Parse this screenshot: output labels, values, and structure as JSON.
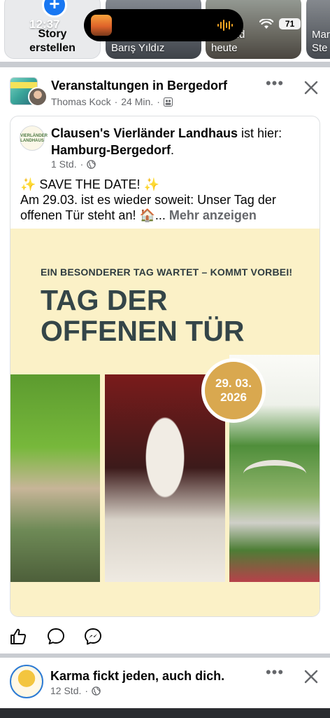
{
  "status_bar": {
    "time": "12:37",
    "battery": "71"
  },
  "stories": {
    "create_label": "Story\nerstellen",
    "items": [
      {
        "name": "Barış Yıldız"
      },
      {
        "name": "als und\nheute"
      },
      {
        "name": "Mar\nSte"
      }
    ]
  },
  "post": {
    "group_name": "Veranstaltungen in Bergedorf",
    "author": "Thomas Kock",
    "time": "24 Min.",
    "more_label": "•••",
    "shared": {
      "page_name": "Clausen's Vierländer Landhaus",
      "is_here_text": " ist hier: ",
      "location": "Hamburg-Bergedorf",
      "location_suffix": ".",
      "avatar_text": "VIERLÄNDER LANDHAUS",
      "time": "1 Std.",
      "body_line1": "✨ SAVE THE DATE! ✨",
      "body_line2": "Am 29.03. ist es wieder soweit: Unser Tag der offenen Tür steht an! 🏠...",
      "more_text": "Mehr anzeigen",
      "event": {
        "subtitle": "EIN BESONDERER TAG WARTET – KOMMT VORBEI!",
        "title_line1": "TAG DER",
        "title_line2": "OFFENEN TÜR",
        "date": "29. 03.\n2026"
      }
    }
  },
  "next_post": {
    "title": "Karma fickt jeden, auch dich.",
    "time": "12 Std.",
    "more_label": "•••"
  },
  "colors": {
    "accent": "#1877f2",
    "meta_gray": "#65676b",
    "event_bg": "#fbf1c7",
    "badge": "#d9a84f",
    "title_slate": "#344548"
  }
}
